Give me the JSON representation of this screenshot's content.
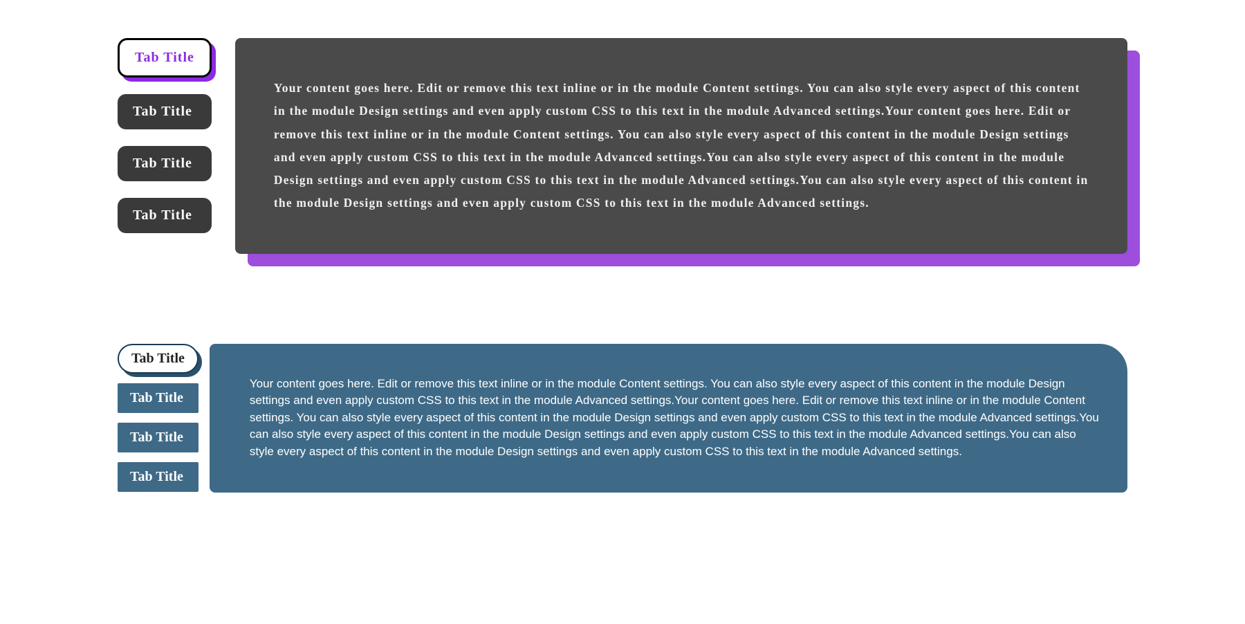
{
  "section1": {
    "tabs": [
      {
        "label": "Tab Title",
        "active": true
      },
      {
        "label": "Tab Title",
        "active": false
      },
      {
        "label": "Tab Title",
        "active": false
      },
      {
        "label": "Tab Title",
        "active": false
      }
    ],
    "content": "Your content goes here. Edit or remove this text inline or in the module Content settings. You can also style every aspect of this content in the module Design settings and even apply custom CSS to this text in the module Advanced settings.Your content goes here. Edit or remove this text inline or in the module Content settings. You can also style every aspect of this content in the module Design settings and even apply custom CSS to this text in the module Advanced settings.You can also style every aspect of this content in the module Design settings and even apply custom CSS to this text in the module Advanced settings.You can also style every aspect of this content in the module Design settings and even apply custom CSS to this text in the module Advanced settings.",
    "colors": {
      "accent": "#8a2be2",
      "dark": "#3a3a3a",
      "panel": "#4a4a4a"
    }
  },
  "section2": {
    "tabs": [
      {
        "label": "Tab Title",
        "active": true
      },
      {
        "label": "Tab Title",
        "active": false
      },
      {
        "label": "Tab Title",
        "active": false
      },
      {
        "label": "Tab Title",
        "active": false
      }
    ],
    "content": "Your content goes here. Edit or remove this text inline or in the module Content settings. You can also style every aspect of this content in the module Design settings and even apply custom CSS to this text in the module Advanced settings.Your content goes here. Edit or remove this text inline or in the module Content settings. You can also style every aspect of this content in the module Design settings and even apply custom CSS to this text in the module Advanced settings.You can also style every aspect of this content in the module Design settings and even apply custom CSS to this text in the module Advanced settings.You can also style every aspect of this content in the module Design settings and even apply custom CSS to this text in the module Advanced settings.",
    "colors": {
      "accent": "#3e6a87",
      "darkline": "#1d3a52"
    }
  }
}
